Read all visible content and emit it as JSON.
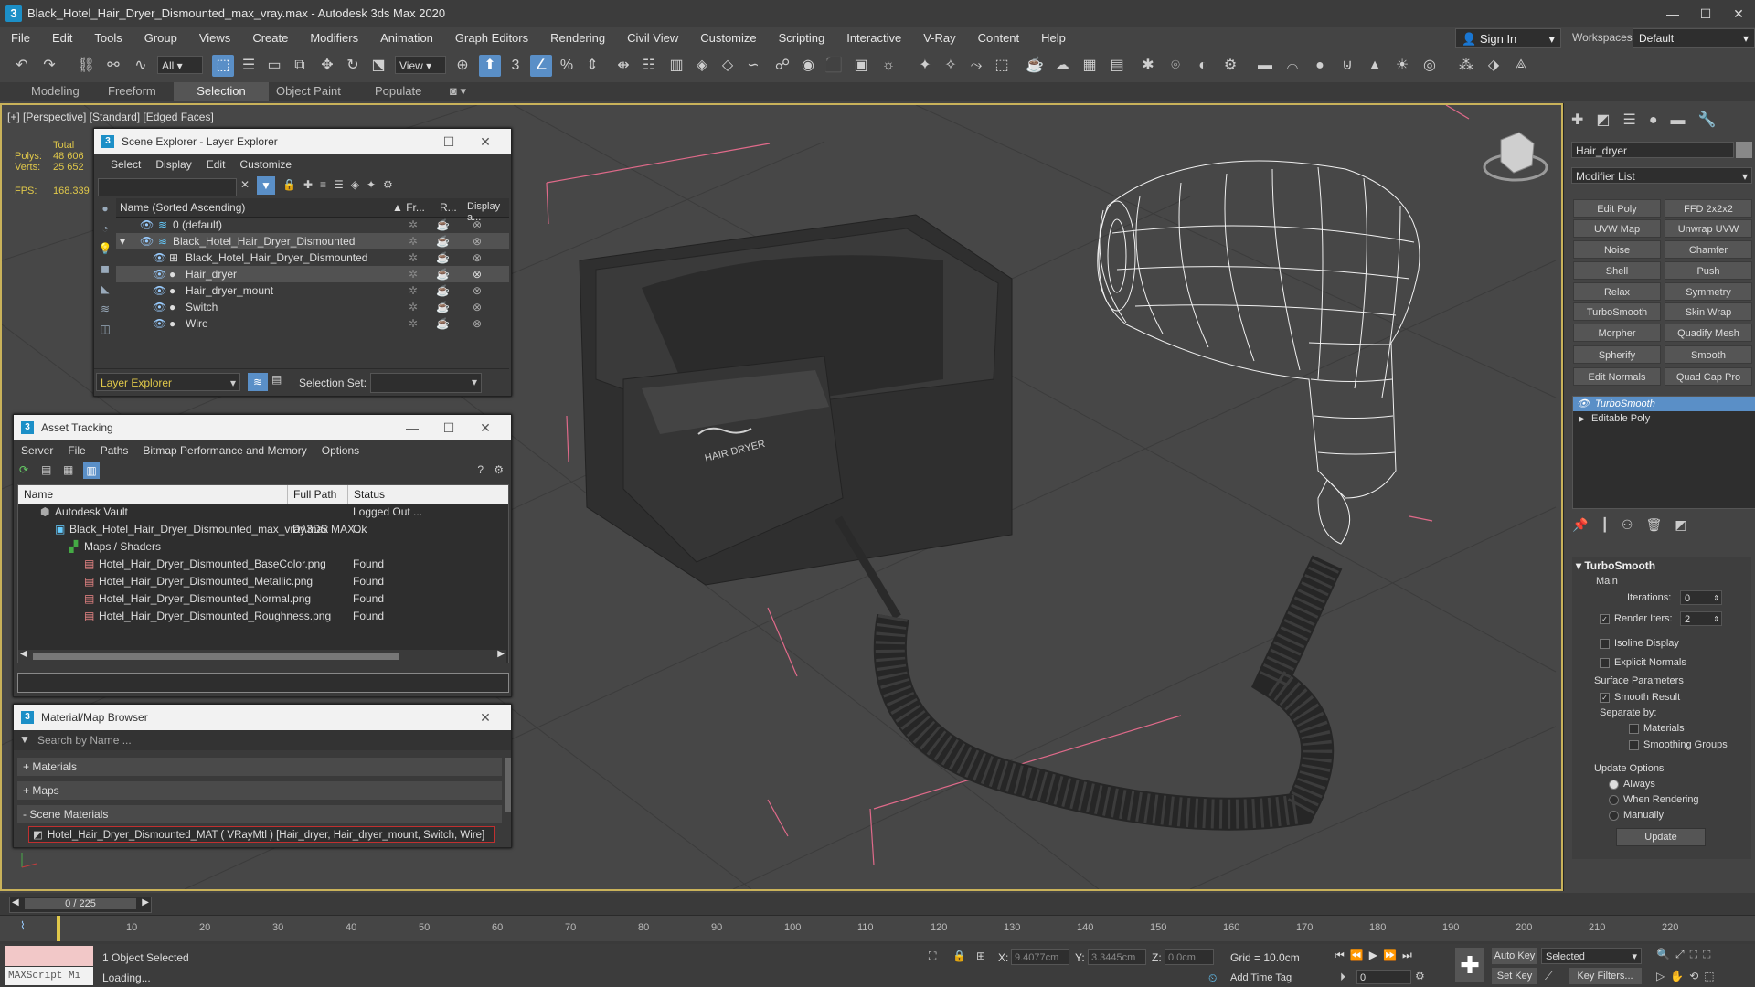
{
  "window": {
    "title": "Black_Hotel_Hair_Dryer_Dismounted_max_vray.max - Autodesk 3ds Max 2020",
    "logo": "3"
  },
  "menu": [
    "File",
    "Edit",
    "Tools",
    "Group",
    "Views",
    "Create",
    "Modifiers",
    "Animation",
    "Graph Editors",
    "Rendering",
    "Civil View",
    "Customize",
    "Scripting",
    "Interactive",
    "V-Ray",
    "Content",
    "Help"
  ],
  "signin": "Sign In",
  "workspaces_label": "Workspaces:",
  "workspaces_value": "Default",
  "toolbar": {
    "selection_filter": "All",
    "ref_coord": "View"
  },
  "ribbon_tabs": [
    "Modeling",
    "Freeform",
    "Selection",
    "Object Paint",
    "Populate"
  ],
  "viewport": {
    "label": "[+] [Perspective] [Standard] [Edged Faces]",
    "stats": {
      "total": "Total",
      "polys_label": "Polys:",
      "polys": "48 606",
      "verts_label": "Verts:",
      "verts": "25 652",
      "fps_label": "FPS:",
      "fps": "168.339"
    },
    "dryer_logo": "HAIR DRYER"
  },
  "scene_explorer": {
    "title": "Scene Explorer - Layer Explorer",
    "menu": [
      "Select",
      "Display",
      "Edit",
      "Customize"
    ],
    "col_name": "Name (Sorted Ascending)",
    "col_fr": "▲ Fr...",
    "col_r": "R...",
    "col_display": "Display a...",
    "rows": [
      {
        "label": "0 (default)",
        "indent": 1
      },
      {
        "label": "Black_Hotel_Hair_Dryer_Dismounted",
        "indent": 1
      },
      {
        "label": "Black_Hotel_Hair_Dryer_Dismounted",
        "indent": 2
      },
      {
        "label": "Hair_dryer",
        "indent": 2
      },
      {
        "label": "Hair_dryer_mount",
        "indent": 2
      },
      {
        "label": "Switch",
        "indent": 2
      },
      {
        "label": "Wire",
        "indent": 2
      }
    ],
    "footer_dropdown": "Layer Explorer",
    "selection_set_label": "Selection Set:"
  },
  "asset_tracking": {
    "title": "Asset Tracking",
    "menu": [
      "Server",
      "File",
      "Paths",
      "Bitmap Performance and Memory",
      "Options"
    ],
    "col_name": "Name",
    "col_path": "Full Path",
    "col_status": "Status",
    "rows": [
      {
        "name": "Autodesk Vault",
        "path": "",
        "status": "Logged Out ..."
      },
      {
        "name": "Black_Hotel_Hair_Dryer_Dismounted_max_vray.max",
        "path": "D:\\3DS MAX...",
        "status": "Ok"
      },
      {
        "name": "Maps / Shaders",
        "path": "",
        "status": ""
      },
      {
        "name": "Hotel_Hair_Dryer_Dismounted_BaseColor.png",
        "path": "",
        "status": "Found"
      },
      {
        "name": "Hotel_Hair_Dryer_Dismounted_Metallic.png",
        "path": "",
        "status": "Found"
      },
      {
        "name": "Hotel_Hair_Dryer_Dismounted_Normal.png",
        "path": "",
        "status": "Found"
      },
      {
        "name": "Hotel_Hair_Dryer_Dismounted_Roughness.png",
        "path": "",
        "status": "Found"
      }
    ]
  },
  "material_browser": {
    "title": "Material/Map Browser",
    "search_placeholder": "Search by Name ...",
    "groups": [
      "+ Materials",
      "+ Maps",
      "- Scene Materials"
    ],
    "scene_material": "Hotel_Hair_Dryer_Dismounted_MAT  ( VRayMtl )  [Hair_dryer, Hair_dryer_mount, Switch, Wire]"
  },
  "command_panel": {
    "object_name": "Hair_dryer",
    "modifier_list": "Modifier List",
    "buttons": [
      "Edit Poly",
      "FFD 2x2x2",
      "UVW Map",
      "Unwrap UVW",
      "Noise",
      "Chamfer",
      "Shell",
      "Push",
      "Relax",
      "Symmetry",
      "TurboSmooth",
      "Skin Wrap",
      "Morpher",
      "Quadify Mesh",
      "Spherify",
      "Smooth",
      "Edit Normals",
      "Quad Cap Pro"
    ],
    "stack": [
      "TurboSmooth",
      "Editable Poly"
    ],
    "rollout_title": "TurboSmooth",
    "main_label": "Main",
    "iterations_label": "Iterations:",
    "iterations": "0",
    "render_iters_label": "Render Iters:",
    "render_iters": "2",
    "isoline": "Isoline Display",
    "explicit": "Explicit Normals",
    "surface_params": "Surface Parameters",
    "smooth_result": "Smooth Result",
    "separate_by": "Separate by:",
    "materials": "Materials",
    "smoothing_groups": "Smoothing Groups",
    "update_options": "Update Options",
    "always": "Always",
    "when_rendering": "When Rendering",
    "manually": "Manually",
    "update_btn": "Update"
  },
  "timeline": {
    "frame": "0 / 225",
    "ticks": [
      "10",
      "20",
      "30",
      "40",
      "50",
      "60",
      "70",
      "80",
      "90",
      "100",
      "110",
      "120",
      "130",
      "140",
      "150",
      "160",
      "170",
      "180",
      "190",
      "200",
      "210",
      "220"
    ]
  },
  "status": {
    "maxscript": "MAXScript Mi",
    "selected": "1 Object Selected",
    "loading": "Loading...",
    "x_label": "X:",
    "x": "9.4077cm",
    "y_label": "Y:",
    "y": "3.3445cm",
    "z_label": "Z:",
    "z": "0.0cm",
    "grid": "Grid = 10.0cm",
    "add_time_tag": "Add Time Tag",
    "auto_key": "Auto Key",
    "set_key": "Set Key",
    "selected_dropdown": "Selected",
    "key_filters": "Key Filters...",
    "frame_field": "0"
  }
}
